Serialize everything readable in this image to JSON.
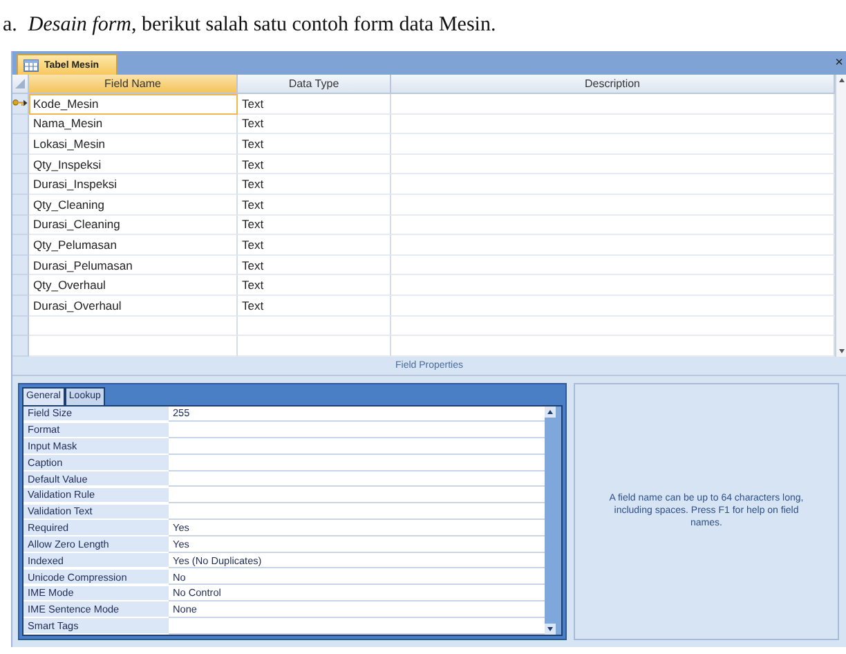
{
  "caption": {
    "marker": "a.",
    "text": "*Desain form*, berikut salah satu contoh form data Mesin."
  },
  "window": {
    "tab": "Tabel Mesin",
    "close": "×"
  },
  "table": {
    "columns": [
      "Field Name",
      "Data Type",
      "Description"
    ],
    "rows": [
      {
        "name": "Kode_Mesin",
        "type": "Text",
        "selected": true,
        "primary_key": true
      },
      {
        "name": "Nama_Mesin",
        "type": "Text",
        "selected": false,
        "primary_key": false
      },
      {
        "name": "Lokasi_Mesin",
        "type": "Text",
        "selected": false,
        "primary_key": false
      },
      {
        "name": "Qty_Inspeksi",
        "type": "Text",
        "selected": false,
        "primary_key": false
      },
      {
        "name": "Durasi_Inspeksi",
        "type": "Text",
        "selected": false,
        "primary_key": false
      },
      {
        "name": "Qty_Cleaning",
        "type": "Text",
        "selected": false,
        "primary_key": false
      },
      {
        "name": "Durasi_Cleaning",
        "type": "Text",
        "selected": false,
        "primary_key": false
      },
      {
        "name": "Qty_Pelumasan",
        "type": "Text",
        "selected": false,
        "primary_key": false
      },
      {
        "name": "Durasi_Pelumasan",
        "type": "Text",
        "selected": false,
        "primary_key": false
      },
      {
        "name": "Qty_Overhaul",
        "type": "Text",
        "selected": false,
        "primary_key": false
      },
      {
        "name": "Durasi_Overhaul",
        "type": "Text",
        "selected": false,
        "primary_key": false
      }
    ]
  },
  "field_properties": {
    "title": "Field Properties",
    "tabs": [
      {
        "label": "General",
        "selected": true
      },
      {
        "label": "Lookup",
        "selected": false
      }
    ],
    "properties": [
      {
        "name": "Field Size",
        "value": "255"
      },
      {
        "name": "Format"
      },
      {
        "name": "Input Mask"
      },
      {
        "name": "Caption"
      },
      {
        "name": "Default Value"
      },
      {
        "name": "Validation Rule"
      },
      {
        "name": "Validation Text"
      },
      {
        "name": "Required",
        "value": "Yes"
      },
      {
        "name": "Allow Zero Length",
        "value": "Yes"
      },
      {
        "name": "Indexed",
        "value": "Yes (No Duplicates)"
      },
      {
        "name": "Unicode Compression",
        "value": "No"
      },
      {
        "name": "IME Mode",
        "value": "No Control"
      },
      {
        "name": "IME Sentence Mode",
        "value": "None"
      },
      {
        "name": "Smart Tags"
      }
    ],
    "help": "A field name can be up to 64 characters long, including spaces.  Press F1 for help on field names."
  }
}
